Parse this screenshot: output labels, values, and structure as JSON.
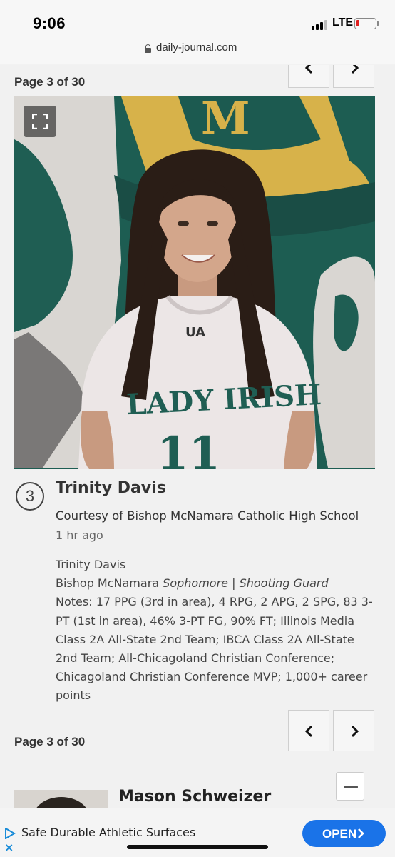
{
  "status_bar": {
    "time": "9:06",
    "network": "LTE",
    "battery_color": "#e02020"
  },
  "browser": {
    "url": "daily-journal.com"
  },
  "pager": {
    "label": "Page 3 of 30"
  },
  "photo": {
    "alt_icon": "fullscreen-icon"
  },
  "item": {
    "number": "3",
    "name": "Trinity Davis",
    "credit": "Courtesy of Bishop McNamara Catholic High School",
    "time_ago": "1 hr ago",
    "desc_name": "Trinity Davis",
    "desc_school": "Bishop McNamara",
    "desc_year": "Sophomore",
    "desc_sep": "|",
    "desc_position": "Shooting Guard",
    "desc_notes": "Notes: 17 PPG (3rd in area), 4 RPG, 2 APG, 2 SPG, 83 3-PT (1st in area), 46% 3-PT FG, 90% FT; Illinois Media Class 2A All-State 2nd Team; IBCA Class 2A All-State 2nd Team; All-Chicagoland Christian Conference; Chicagoland Christian Conference MVP; 1,000+ career points"
  },
  "next_item": {
    "name": "Mason Schweizer"
  },
  "ad": {
    "text": "Safe Durable Athletic Surfaces",
    "cta": "OPEN",
    "accent": "#1a73e8"
  }
}
